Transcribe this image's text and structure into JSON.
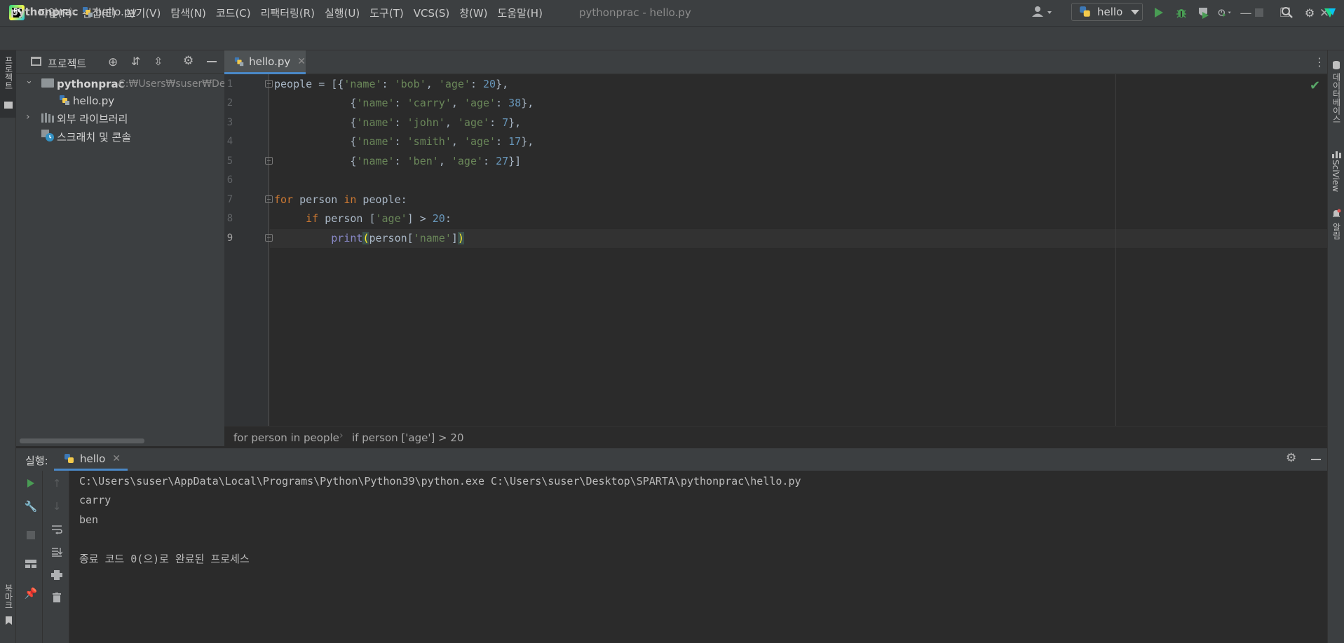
{
  "titlebar": {
    "logo_text": "PC",
    "menu": [
      "파일(F)",
      "편집(E)",
      "보기(V)",
      "탐색(N)",
      "코드(C)",
      "리팩터링(R)",
      "실행(U)",
      "도구(T)",
      "VCS(S)",
      "창(W)",
      "도움말(H)"
    ],
    "window_title": "pythonprac - hello.py"
  },
  "navbar": {
    "project": "pythonprac",
    "file": "hello.py",
    "run_config": "hello"
  },
  "left_stripe": {
    "project_label": "프로젝트",
    "bookmarks_label": "북마크"
  },
  "right_stripe": {
    "database_label": "데이터베이스",
    "sciview_label": "SciView",
    "notifications_label": "알림"
  },
  "project_panel": {
    "title": "프로젝트",
    "root": {
      "name": "pythonprac",
      "path": "C:₩Users₩suser₩Desk"
    },
    "file": "hello.py",
    "external_libs": "외부 라이브러리",
    "scratches": "스크래치 및 콘솔"
  },
  "editor": {
    "tab": "hello.py",
    "line_numbers": [
      "1",
      "2",
      "3",
      "4",
      "5",
      "6",
      "7",
      "8",
      "9"
    ],
    "breadcrumb": [
      "for person in people",
      "if person ['age'] > 20"
    ]
  },
  "run_panel": {
    "title": "실행:",
    "tab": "hello",
    "console": [
      "C:\\Users\\suser\\AppData\\Local\\Programs\\Python\\Python39\\python.exe C:\\Users\\suser\\Desktop\\SPARTA\\pythonprac\\hello.py",
      "carry",
      "ben",
      "",
      "종료 코드 0(으)로 완료된 프로세스"
    ]
  },
  "colors": {
    "keyword": "#cc7832",
    "string": "#6a8759",
    "number": "#6897bb",
    "builtin": "#8888c6",
    "accent": "#4a88c7",
    "run_green": "#499c54"
  },
  "icons": [
    "app-logo-icon",
    "minimize-icon",
    "restore-icon",
    "close-icon",
    "python-file-icon",
    "user-icon",
    "run-icon",
    "debug-icon",
    "coverage-icon",
    "profile-icon",
    "stop-icon",
    "search-icon",
    "gear-icon",
    "folder-icon",
    "library-icon",
    "scratch-icon",
    "check-icon"
  ]
}
